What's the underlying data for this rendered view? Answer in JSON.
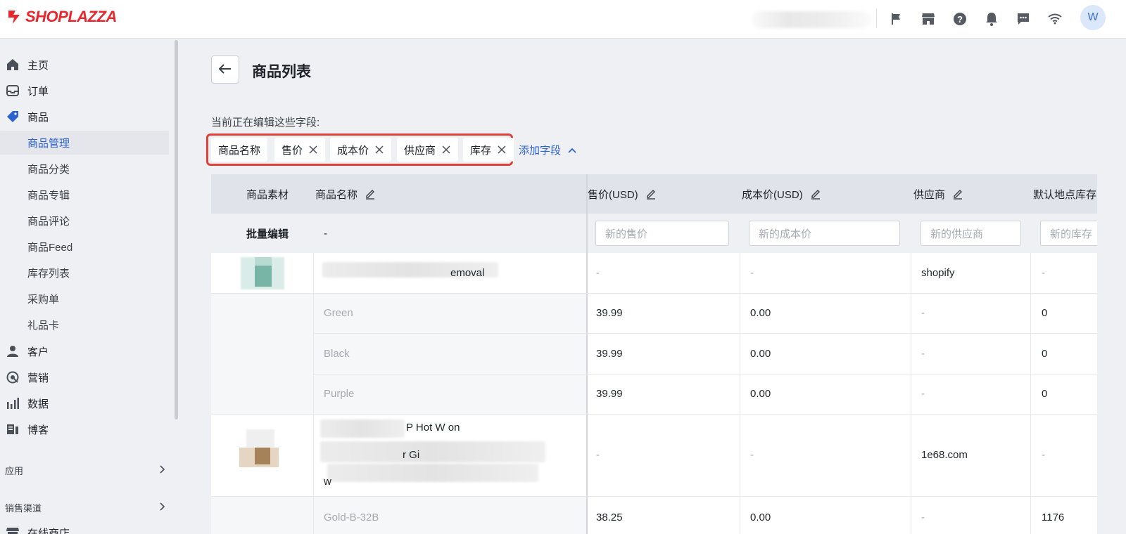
{
  "brand": {
    "name": "SHOPLAZZA",
    "color": "#e8262d"
  },
  "topbar": {
    "icons": [
      "flag-icon",
      "store-icon",
      "help-icon",
      "bell-icon",
      "chat-icon",
      "wifi-icon"
    ],
    "avatar_initial": "W"
  },
  "sidebar": {
    "items": [
      {
        "label": "主页",
        "icon": "home-icon"
      },
      {
        "label": "订单",
        "icon": "inbox-icon"
      },
      {
        "label": "商品",
        "icon": "tag-icon"
      },
      {
        "label": "客户",
        "icon": "person-icon"
      },
      {
        "label": "营销",
        "icon": "target-icon"
      },
      {
        "label": "数据",
        "icon": "bar-chart-icon"
      },
      {
        "label": "博客",
        "icon": "blog-icon"
      },
      {
        "label": "在线商店",
        "icon": "shop-icon"
      }
    ],
    "product_sub": [
      "商品管理",
      "商品分类",
      "商品专辑",
      "商品评论",
      "商品Feed",
      "库存列表",
      "采购单",
      "礼品卡"
    ],
    "sections": {
      "apps": "应用",
      "channels": "销售渠道"
    }
  },
  "page": {
    "title": "商品列表",
    "editing_label": "当前正在编辑这些字段:",
    "tags": [
      "商品名称",
      "售价",
      "成本价",
      "供应商",
      "库存"
    ],
    "add_field": "添加字段"
  },
  "table": {
    "headers": {
      "media": "商品素材",
      "name": "商品名称",
      "price": "售价(USD)",
      "cost": "成本价(USD)",
      "vendor": "供应商",
      "stock": "默认地点库存"
    },
    "batch": {
      "label": "批量编辑",
      "name_value": "-",
      "price_placeholder": "新的售价",
      "cost_placeholder": "新的成本价",
      "vendor_placeholder": "新的供应商",
      "stock_placeholder": "新的库存"
    },
    "rows": [
      {
        "name": "emoval",
        "price": "-",
        "cost": "-",
        "vendor": "shopify",
        "stock": "-"
      },
      {
        "name": "Green",
        "price": "39.99",
        "cost": "0.00",
        "vendor": "-",
        "stock": "0"
      },
      {
        "name": "Black",
        "price": "39.99",
        "cost": "0.00",
        "vendor": "-",
        "stock": "0"
      },
      {
        "name": "Purple",
        "price": "39.99",
        "cost": "0.00",
        "vendor": "-",
        "stock": "0"
      },
      {
        "name_line1": "P Hot W on",
        "name_line2": "r Gi",
        "name_line3": "w",
        "price": "-",
        "cost": "-",
        "vendor": "1e68.com",
        "stock": "-"
      },
      {
        "name": "Gold-B-32B",
        "price": "38.25",
        "cost": "0.00",
        "vendor": "-",
        "stock": "1176"
      }
    ]
  }
}
